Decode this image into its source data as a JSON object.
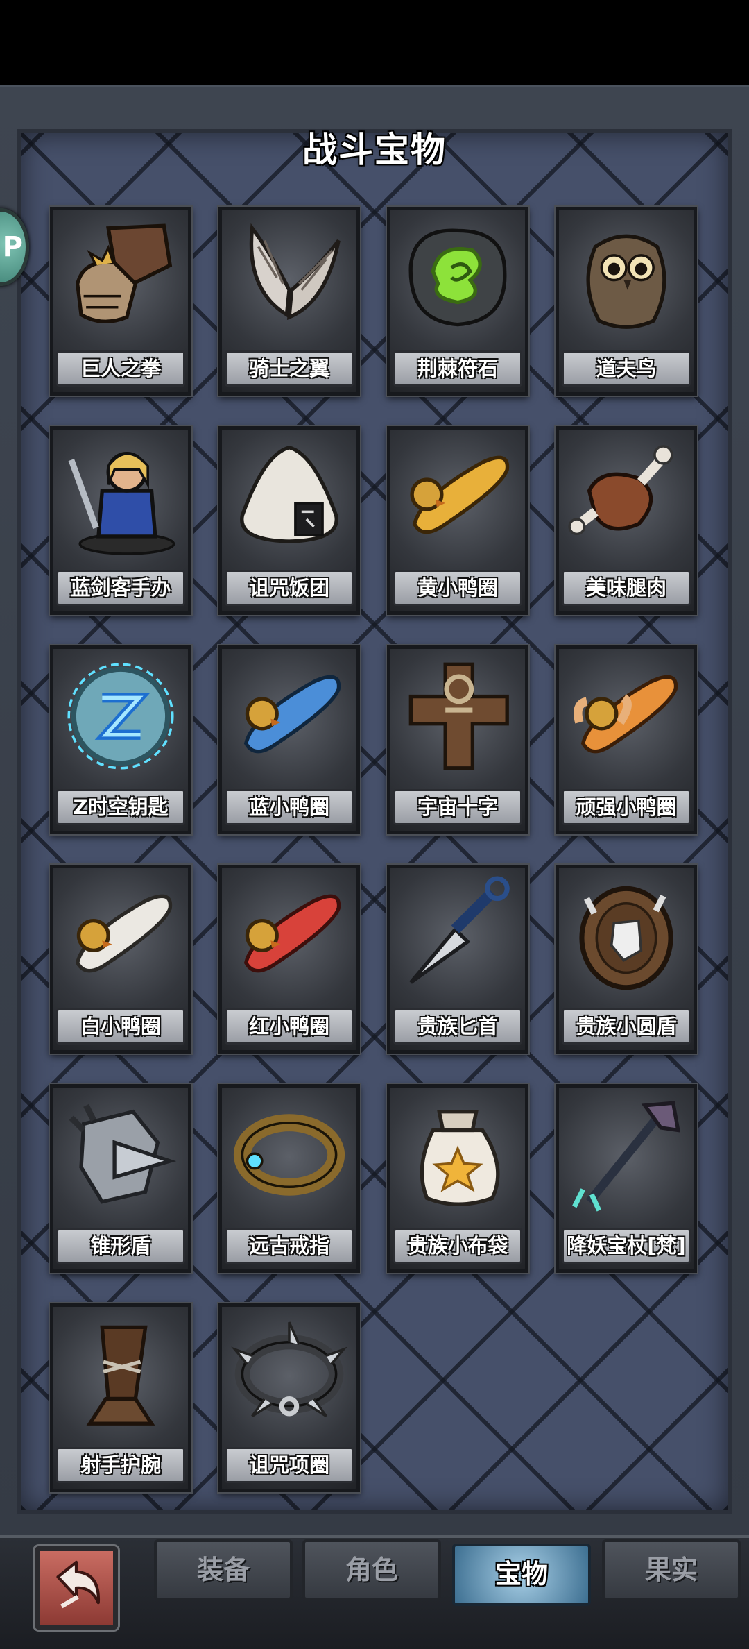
{
  "header": {
    "title": "战斗宝物"
  },
  "side_bubble": {
    "glyph": "P"
  },
  "items": [
    {
      "name": "巨人之拳",
      "icon": "giant-fist-icon"
    },
    {
      "name": "骑士之翼",
      "icon": "knight-wings-icon"
    },
    {
      "name": "荆棘符石",
      "icon": "thorn-rune-stone-icon"
    },
    {
      "name": "道夫鸟",
      "icon": "dodo-bird-icon"
    },
    {
      "name": "蓝剑客手办",
      "icon": "blue-swordsman-figure-icon"
    },
    {
      "name": "诅咒饭团",
      "icon": "cursed-rice-ball-icon"
    },
    {
      "name": "黄小鸭圈",
      "icon": "yellow-duck-ring-icon"
    },
    {
      "name": "美味腿肉",
      "icon": "tasty-drumstick-icon"
    },
    {
      "name": "Z时空钥匙",
      "icon": "z-spacetime-key-icon"
    },
    {
      "name": "蓝小鸭圈",
      "icon": "blue-duck-ring-icon"
    },
    {
      "name": "宇宙十字",
      "icon": "cosmic-cross-icon"
    },
    {
      "name": "顽强小鸭圈",
      "icon": "tough-duck-ring-icon"
    },
    {
      "name": "白小鸭圈",
      "icon": "white-duck-ring-icon"
    },
    {
      "name": "红小鸭圈",
      "icon": "red-duck-ring-icon"
    },
    {
      "name": "贵族匕首",
      "icon": "noble-dagger-icon"
    },
    {
      "name": "贵族小圆盾",
      "icon": "noble-buckler-icon"
    },
    {
      "name": "锥形盾",
      "icon": "cone-shield-icon"
    },
    {
      "name": "远古戒指",
      "icon": "ancient-ring-icon"
    },
    {
      "name": "贵族小布袋",
      "icon": "noble-pouch-icon"
    },
    {
      "name": "降妖宝杖[梵]",
      "icon": "demon-staff-icon"
    },
    {
      "name": "射手护腕",
      "icon": "archer-bracer-icon"
    },
    {
      "name": "诅咒项圈",
      "icon": "cursed-collar-icon"
    }
  ],
  "bottom_nav": {
    "back_icon": "back-arrow-icon",
    "tabs": [
      {
        "label": "装备",
        "active": false
      },
      {
        "label": "角色",
        "active": false
      },
      {
        "label": "宝物",
        "active": true
      },
      {
        "label": "果实",
        "active": false
      }
    ]
  }
}
